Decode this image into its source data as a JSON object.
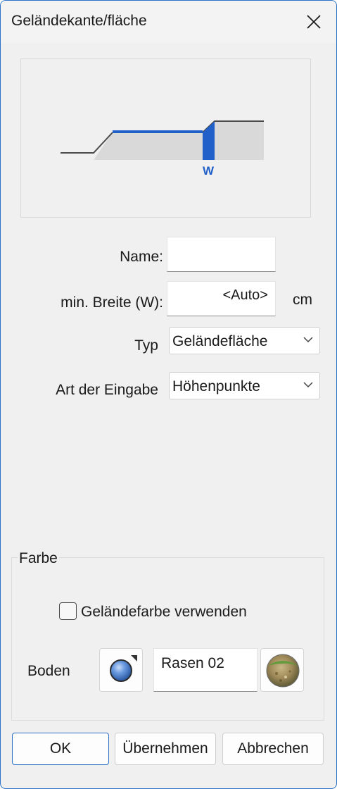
{
  "window": {
    "title": "Geländekante/fläche",
    "close_icon": "close-icon"
  },
  "preview": {
    "marker_label": "W",
    "accent_color": "#2060c8"
  },
  "form": {
    "name_label": "Name:",
    "name_value": "",
    "width_label": "min. Breite (W):",
    "width_value": "<Auto>",
    "width_unit": "cm",
    "type_label": "Typ",
    "type_value": "Geländefläche",
    "input_label": "Art der Eingabe",
    "input_value": "Höhenpunkte"
  },
  "color_group": {
    "title": "Farbe",
    "use_terrain_color_label": "Geländefarbe verwenden",
    "use_terrain_color_checked": false,
    "floor_label": "Boden",
    "floor_value": "Rasen 02"
  },
  "buttons": {
    "ok": "OK",
    "apply": "Übernehmen",
    "cancel": "Abbrechen"
  }
}
